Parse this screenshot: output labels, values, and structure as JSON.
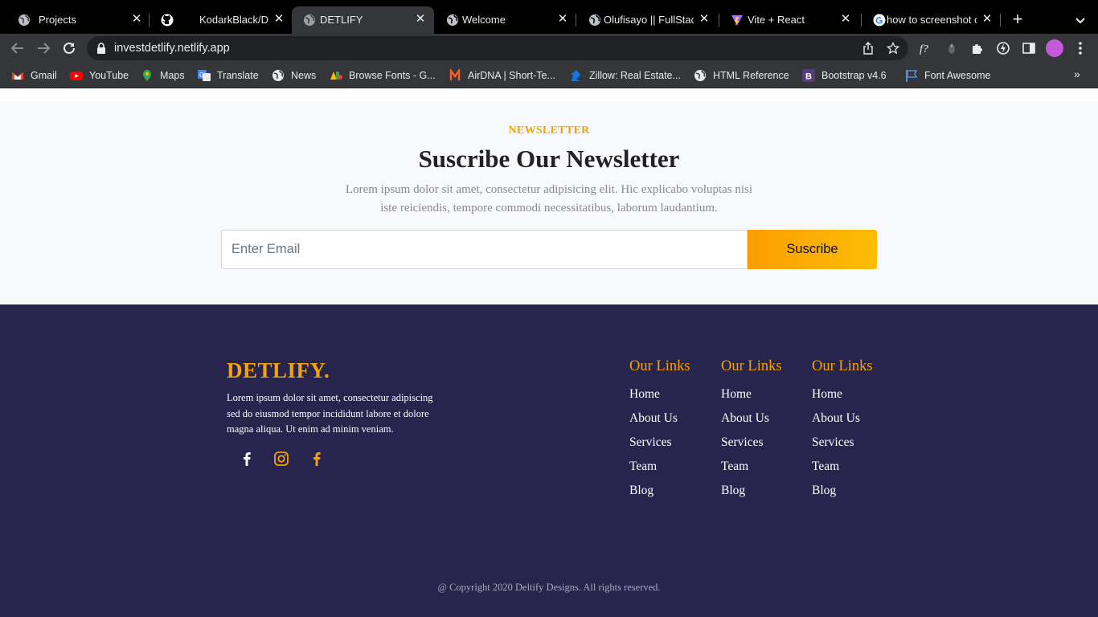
{
  "browser": {
    "tabs": [
      {
        "title": "Projects",
        "icon": "globe-icon"
      },
      {
        "title": "KodarkBlack/Detlify",
        "icon": "github-icon"
      },
      {
        "title": "DETLIFY",
        "icon": "globe-icon",
        "active": true
      },
      {
        "title": "Welcome",
        "icon": "globe-icon"
      },
      {
        "title": "Olufisayo || FullStac",
        "icon": "globe-icon"
      },
      {
        "title": "Vite + React",
        "icon": "vite-icon"
      },
      {
        "title": "how to screenshot o",
        "icon": "google-icon"
      }
    ],
    "close_glyph": "✕",
    "new_tab_glyph": "+",
    "url": "investdetlify.netlify.app",
    "bookmarks": [
      {
        "label": "Gmail",
        "icon": "gmail-icon"
      },
      {
        "label": "YouTube",
        "icon": "youtube-icon"
      },
      {
        "label": "Maps",
        "icon": "maps-icon"
      },
      {
        "label": "Translate",
        "icon": "translate-icon"
      },
      {
        "label": "News",
        "icon": "globe-icon"
      },
      {
        "label": "Browse Fonts - G...",
        "icon": "fonts-icon"
      },
      {
        "label": "AirDNA | Short-Te...",
        "icon": "airdna-icon"
      },
      {
        "label": "Zillow: Real Estate...",
        "icon": "zillow-icon"
      },
      {
        "label": "HTML Reference",
        "icon": "globe-icon"
      },
      {
        "label": "Bootstrap v4.6",
        "icon": "bootstrap-icon"
      },
      {
        "label": "Font Awesome",
        "icon": "flag-icon"
      }
    ],
    "bookmarks_overflow": "»"
  },
  "newsletter": {
    "eyebrow": "NEWSLETTER",
    "title": "Suscribe Our Newsletter",
    "text": "Lorem ipsum dolor sit amet, consectetur adipisicing elit. Hic explicabo voluptas nisi iste reiciendis, tempore commodi necessitatibus, laborum laudantium.",
    "email_placeholder": "Enter Email",
    "button": "Suscribe"
  },
  "footer": {
    "brand": "DETLIFY.",
    "about": "Lorem ipsum dolor sit amet, consectetur adipiscing sed do eiusmod tempor incididunt labore et dolore magna aliqua. Ut enim ad minim veniam.",
    "social": [
      "facebook-icon",
      "instagram-icon",
      "facebook-icon"
    ],
    "columns": [
      {
        "title": "Our Links",
        "links": [
          "Home",
          "About Us",
          "Services",
          "Team",
          "Blog"
        ]
      },
      {
        "title": "Our Links",
        "links": [
          "Home",
          "About Us",
          "Services",
          "Team",
          "Blog"
        ]
      },
      {
        "title": "Our Links",
        "links": [
          "Home",
          "About Us",
          "Services",
          "Team",
          "Blog"
        ]
      }
    ],
    "copyright": "@ Copyright 2020 Deltify Designs. All rights reserved."
  },
  "colors": {
    "accent": "#f5a300",
    "footer_bg": "#27244d",
    "newsletter_bg": "#f8f9fc"
  }
}
